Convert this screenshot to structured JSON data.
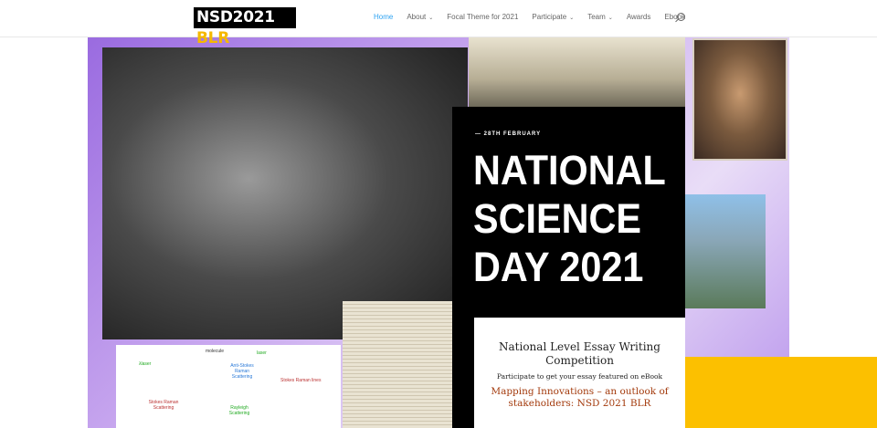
{
  "header": {
    "logo": {
      "main": "NSD2021 ",
      "accent": "BLR"
    },
    "nav": [
      {
        "label": "Home",
        "active": true
      },
      {
        "label": "About",
        "dropdown": true
      },
      {
        "label": "Focal Theme for 2021"
      },
      {
        "label": "Participate",
        "dropdown": true
      },
      {
        "label": "Team",
        "dropdown": true
      },
      {
        "label": "Awards"
      },
      {
        "label": "Ebook"
      }
    ]
  },
  "hero": {
    "date": "— 28TH FEBRUARY",
    "title": "NATIONAL SCIENCE DAY 2021",
    "diagram": {
      "molecule": "molecule",
      "laser_in": "λlaser",
      "anti_stokes": "Anti-Stokes Raman Scattering",
      "rayleigh": "Rayleigh Scattering",
      "stokes": "Stokes Raman Scattering",
      "laser": "laser",
      "stokes_lines": "Stokes Raman lines"
    }
  },
  "card": {
    "heading": "National Level Essay Writing Competition",
    "subtext": "Participate to get your essay featured on eBook",
    "topic": "Mapping Innovations – an outlook of stakeholders: NSD 2021 BLR"
  },
  "colors": {
    "accent": "#fcc000",
    "link": "#2ea3f2",
    "topic": "#a33a0c"
  }
}
